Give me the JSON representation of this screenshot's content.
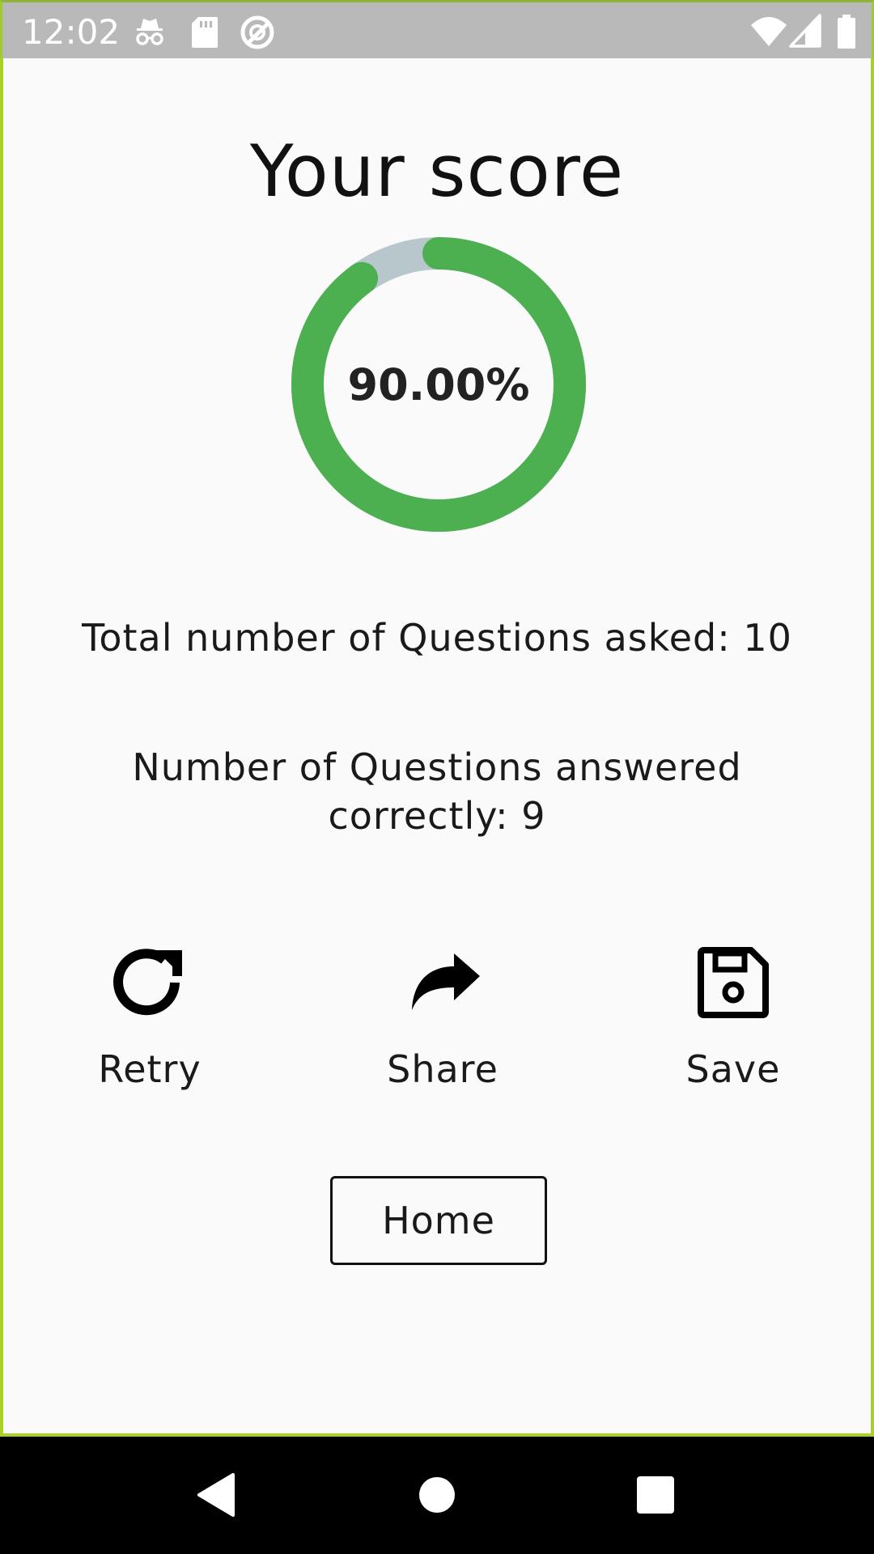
{
  "status_bar": {
    "time": "12:02",
    "icons": [
      "incognito-icon",
      "sd-card-icon",
      "sync-blocked-icon",
      "wifi-icon",
      "signal-icon",
      "battery-icon"
    ]
  },
  "page": {
    "title": "Your score"
  },
  "score": {
    "percent_label": "90.00%",
    "fraction": 0.9,
    "progress_color": "#4caf50",
    "track_color": "#b8c7cc"
  },
  "stats": {
    "total_questions": "Total number of Questions asked: 10",
    "correct_answers": "Number of Questions answered correctly: 9"
  },
  "actions": {
    "retry_label": "Retry",
    "share_label": "Share",
    "save_label": "Save"
  },
  "home_button": {
    "label": "Home"
  },
  "nav_bar": {
    "icons": [
      "back-icon",
      "home-circle-icon",
      "recents-icon"
    ]
  }
}
